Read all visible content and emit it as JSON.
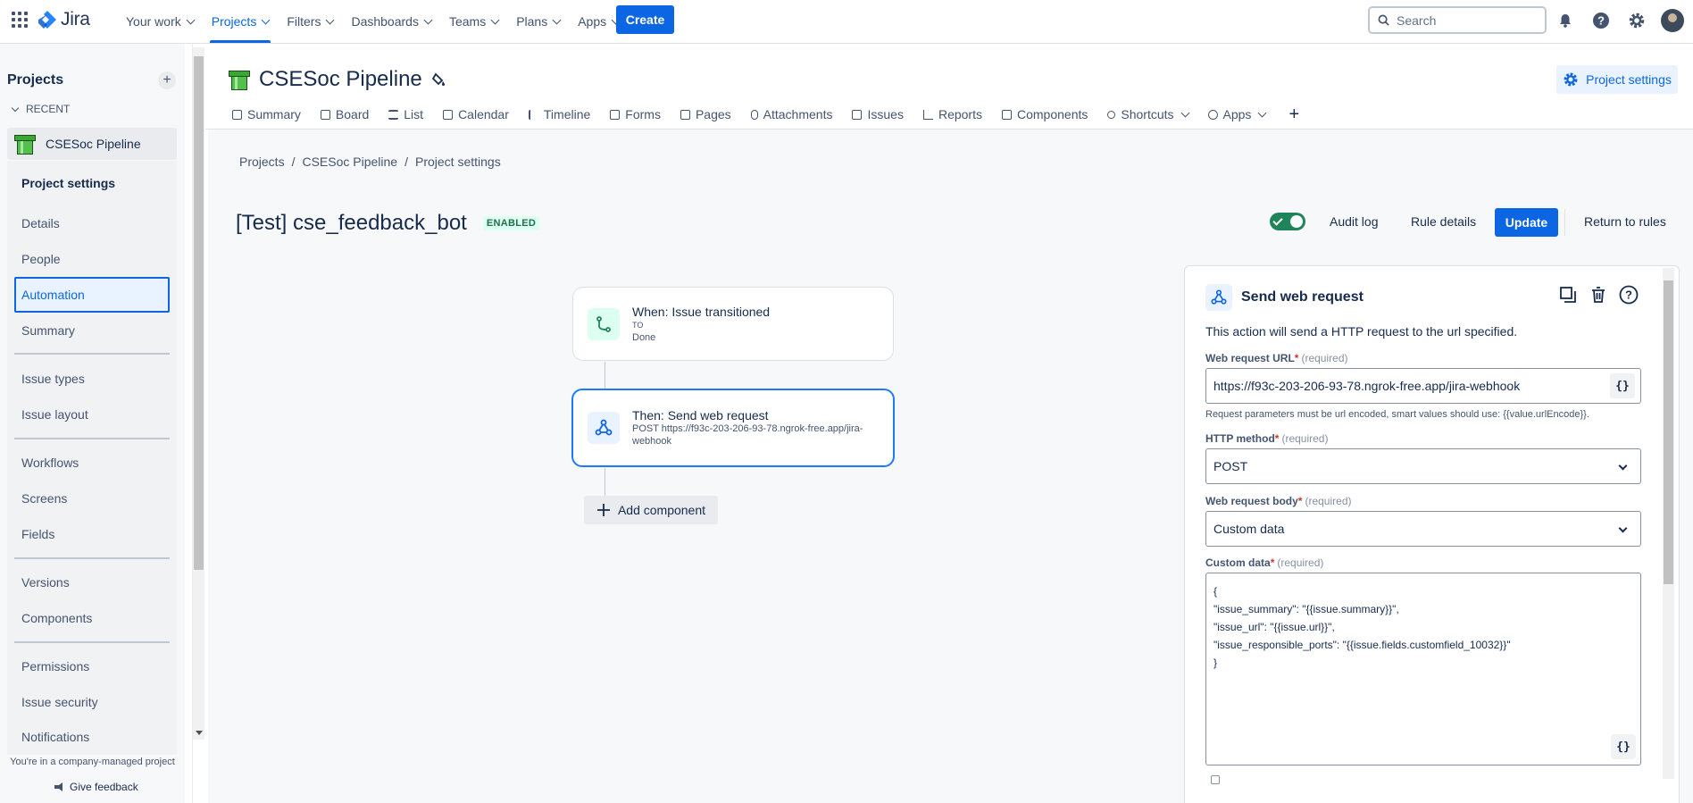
{
  "nav": {
    "logo": "Jira",
    "items": [
      {
        "label": "Your work",
        "active": false
      },
      {
        "label": "Projects",
        "active": true
      },
      {
        "label": "Filters",
        "active": false
      },
      {
        "label": "Dashboards",
        "active": false
      },
      {
        "label": "Teams",
        "active": false
      },
      {
        "label": "Plans",
        "active": false
      },
      {
        "label": "Apps",
        "active": false
      }
    ],
    "create": "Create",
    "search_placeholder": "Search"
  },
  "sidebar": {
    "title": "Projects",
    "recent": "RECENT",
    "project": "CSESoc Pipeline",
    "settings": "Project settings",
    "items": [
      {
        "label": "Details"
      },
      {
        "label": "People"
      },
      {
        "label": "Automation",
        "active": true
      },
      {
        "label": "Summary"
      },
      {
        "label": "Issue types"
      },
      {
        "label": "Issue layout"
      },
      {
        "label": "Workflows"
      },
      {
        "label": "Screens"
      },
      {
        "label": "Fields"
      },
      {
        "label": "Versions"
      },
      {
        "label": "Components"
      },
      {
        "label": "Permissions"
      },
      {
        "label": "Issue security"
      },
      {
        "label": "Notifications"
      }
    ],
    "footer": "You're in a company-managed project",
    "feedback": "Give feedback"
  },
  "project": {
    "title": "CSESoc Pipeline",
    "settings_button": "Project settings",
    "tabs": [
      "Summary",
      "Board",
      "List",
      "Calendar",
      "Timeline",
      "Forms",
      "Pages",
      "Attachments",
      "Issues",
      "Reports",
      "Components",
      "Shortcuts",
      "Apps"
    ]
  },
  "breadcrumb": [
    "Projects",
    "CSESoc Pipeline",
    "Project settings"
  ],
  "rule": {
    "title": "[Test] cse_feedback_bot",
    "status": "ENABLED",
    "audit_log": "Audit log",
    "rule_details": "Rule details",
    "update": "Update",
    "return": "Return to rules"
  },
  "flow": {
    "trigger": {
      "title": "When: Issue transitioned",
      "line1": "TO",
      "line2": "Done"
    },
    "action": {
      "title": "Then: Send web request",
      "line1": "POST https://f93c-203-206-93-78.ngrok-free.app/jira-",
      "line2": "webhook"
    },
    "add": "Add component"
  },
  "panel": {
    "title": "Send web request",
    "description": "This action will send a HTTP request to the url specified.",
    "url_label": "Web request URL",
    "url_value": "https://f93c-203-206-93-78.ngrok-free.app/jira-webhook",
    "url_help": "Request parameters must be url encoded, smart values should use: {{value.urlEncode}}.",
    "method_label": "HTTP method",
    "method_value": "POST",
    "body_label": "Web request body",
    "body_value": "Custom data",
    "custom_label": "Custom data",
    "custom_value": "{\n\"issue_summary\": \"{{issue.summary}}\",\n\"issue_url\": \"{{issue.url}}\",\n\"issue_responsible_ports\": \"{{issue.fields.customfield_10032}}\"\n}",
    "required": "(required)",
    "smart": "{}"
  },
  "colors": {
    "brand": "#0c66e4",
    "success": "#1f845a"
  }
}
